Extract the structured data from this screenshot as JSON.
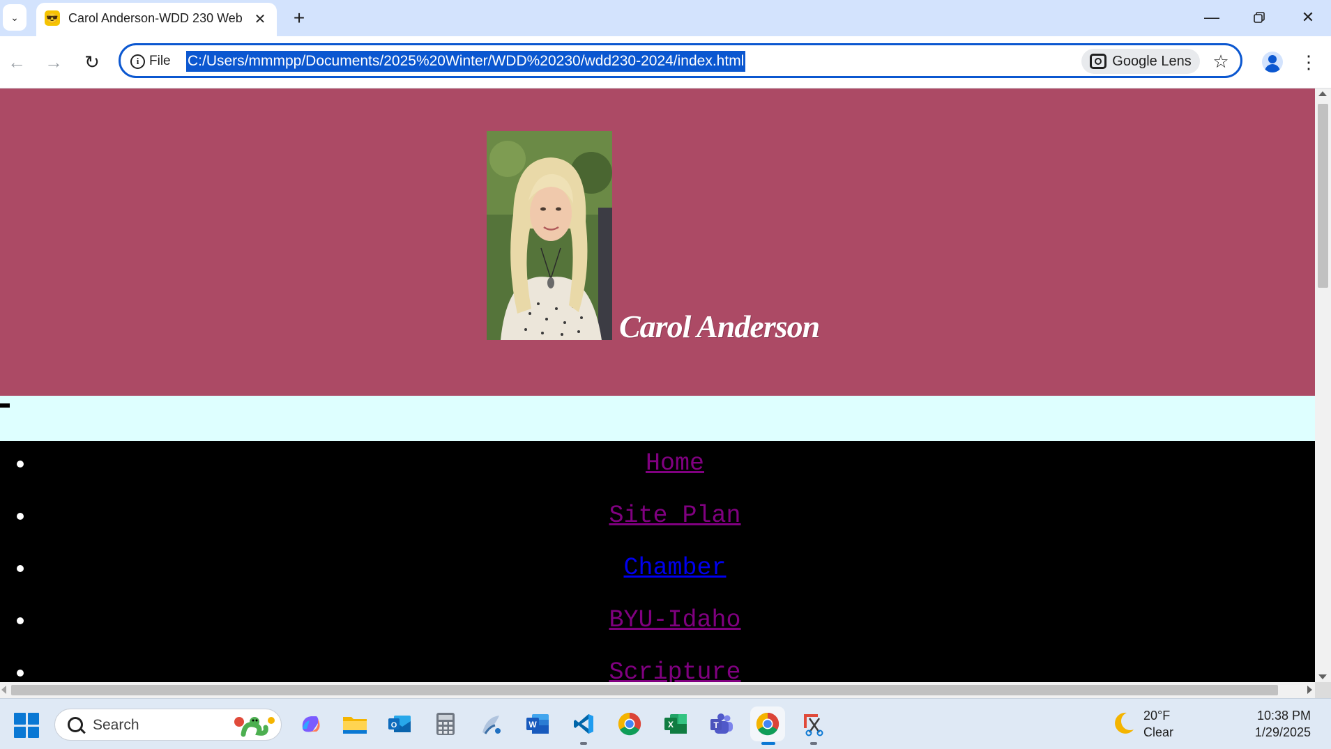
{
  "browser": {
    "tab_title": "Carol Anderson-WDD 230 Web",
    "site_chip": "File",
    "url": "C:/Users/mmmpp/Documents/2025%20Winter/WDD%20230/wdd230-2024/index.html",
    "lens_label": "Google Lens"
  },
  "page": {
    "site_name": "Carol Anderson",
    "header_color": "#ac4a65",
    "band_color": "#deffff",
    "nav": [
      {
        "label": "Home",
        "color": "#800080"
      },
      {
        "label": "Site Plan",
        "color": "#800080"
      },
      {
        "label": "Chamber",
        "color": "#0000ee"
      },
      {
        "label": "BYU-Idaho",
        "color": "#800080"
      },
      {
        "label": "Scripture",
        "color": "#800080"
      }
    ]
  },
  "taskbar": {
    "search_label": "Search",
    "apps": [
      "copilot-icon",
      "file-explorer-icon",
      "outlook-icon",
      "calculator-icon",
      "paint-icon",
      "word-icon",
      "vscode-icon",
      "chrome-icon",
      "excel-icon",
      "teams-icon",
      "chrome-icon",
      "snipping-tool-icon"
    ],
    "weather_temp": "20°F",
    "weather_cond": "Clear",
    "time": "10:38 PM",
    "date": "1/29/2025"
  }
}
